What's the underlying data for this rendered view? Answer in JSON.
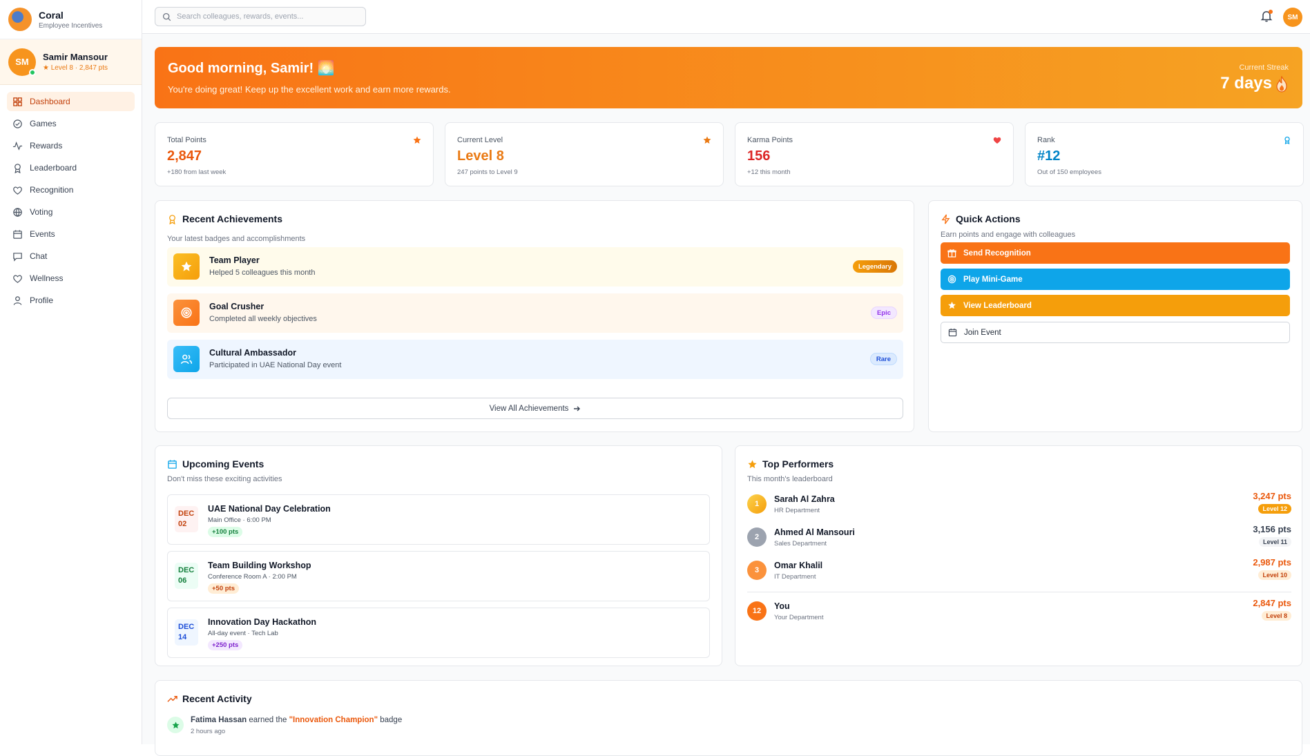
{
  "app": {
    "name": "Coral",
    "subtitle": "Employee Incentives"
  },
  "user": {
    "initials": "SM",
    "name": "Samir Mansour",
    "meta": "Level 8 · 2,847 pts"
  },
  "nav": [
    {
      "label": "Dashboard",
      "icon": "grid-icon",
      "active": true
    },
    {
      "label": "Games",
      "icon": "gamepad-icon"
    },
    {
      "label": "Rewards",
      "icon": "activity-icon"
    },
    {
      "label": "Leaderboard",
      "icon": "award-icon"
    },
    {
      "label": "Recognition",
      "icon": "heart-icon"
    },
    {
      "label": "Voting",
      "icon": "globe-icon"
    },
    {
      "label": "Events",
      "icon": "calendar-icon"
    },
    {
      "label": "Chat",
      "icon": "chat-icon"
    },
    {
      "label": "Wellness",
      "icon": "heart-icon"
    },
    {
      "label": "Profile",
      "icon": "user-icon"
    }
  ],
  "topbar": {
    "search_placeholder": "Search colleagues, rewards, events...",
    "avatar_initials": "SM"
  },
  "hero": {
    "greeting": "Good morning, Samir! 🌅",
    "subtitle": "You're doing great! Keep up the excellent work and earn more rewards.",
    "streak_label": "Current Streak",
    "streak_value": "7 days"
  },
  "stats": [
    {
      "label": "Total Points",
      "value": "2,847",
      "sub": "+180 from last week",
      "color": "#ea580c"
    },
    {
      "label": "Current Level",
      "value": "Level 8",
      "sub": "247 points to Level 9",
      "color": "#ea7a14"
    },
    {
      "label": "Karma Points",
      "value": "156",
      "sub": "+12 this month",
      "color": "#dc2626"
    },
    {
      "label": "Rank",
      "value": "#12",
      "sub": "Out of 150 employees",
      "color": "#0284c7"
    }
  ],
  "achievements": {
    "title": "Recent Achievements",
    "subtitle": "Your latest badges and accomplishments",
    "items": [
      {
        "name": "Team Player",
        "desc": "Helped 5 colleagues this month",
        "badge": "Legendary"
      },
      {
        "name": "Goal Crusher",
        "desc": "Completed all weekly objectives",
        "badge": "Epic"
      },
      {
        "name": "Cultural Ambassador",
        "desc": "Participated in UAE National Day event",
        "badge": "Rare"
      }
    ],
    "view_all": "View All Achievements"
  },
  "quick_actions": {
    "title": "Quick Actions",
    "subtitle": "Earn points and engage with colleagues",
    "items": [
      {
        "label": "Send Recognition",
        "color": "#f97316"
      },
      {
        "label": "Play Mini-Game",
        "color": "#0ea5e9"
      },
      {
        "label": "View Leaderboard",
        "color": "#f59e0b"
      },
      {
        "label": "Join Event",
        "color": "#ffffff"
      }
    ]
  },
  "events": {
    "title": "Upcoming Events",
    "subtitle": "Don't miss these exciting activities",
    "items": [
      {
        "month": "DEC",
        "day": "02",
        "name": "UAE National Day Celebration",
        "meta": "Main Office · 6:00 PM",
        "pts": "+100 pts"
      },
      {
        "month": "DEC",
        "day": "06",
        "name": "Team Building Workshop",
        "meta": "Conference Room A · 2:00 PM",
        "pts": "+50 pts"
      },
      {
        "month": "DEC",
        "day": "14",
        "name": "Innovation Day Hackathon",
        "meta": "All-day event · Tech Lab",
        "pts": "+250 pts"
      }
    ]
  },
  "performers": {
    "title": "Top Performers",
    "subtitle": "This month's leaderboard",
    "items": [
      {
        "rank": "1",
        "name": "Sarah Al Zahra",
        "dept": "HR Department",
        "pts": "3,247 pts",
        "level": "Level 12"
      },
      {
        "rank": "2",
        "name": "Ahmed Al Mansouri",
        "dept": "Sales Department",
        "pts": "3,156 pts",
        "level": "Level 11"
      },
      {
        "rank": "3",
        "name": "Omar Khalil",
        "dept": "IT Department",
        "pts": "2,987 pts",
        "level": "Level 10"
      },
      {
        "rank": "12",
        "name": "You",
        "dept": "Your Department",
        "pts": "2,847 pts",
        "level": "Level 8"
      }
    ]
  },
  "activity": {
    "title": "Recent Activity",
    "items": [
      {
        "actor": "Fatima Hassan",
        "verb": " earned the ",
        "object": "\"Innovation Champion\"",
        "suffix": " badge",
        "time": "2 hours ago"
      }
    ]
  }
}
